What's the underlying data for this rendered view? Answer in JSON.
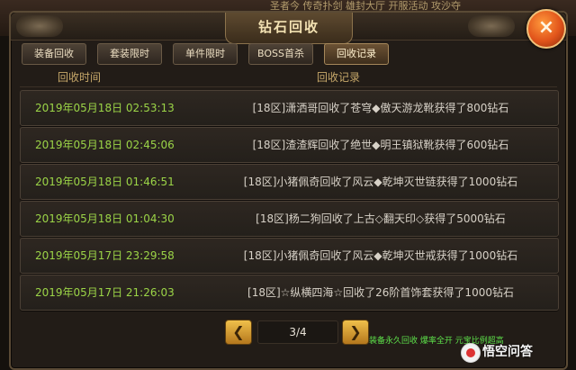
{
  "background": {
    "ticker": "圣者今  传奇扑剑 雄封大厅 开服活动 攻沙夺",
    "bottom_notice": "装备永久回收  爆率全开  元宝比例超高"
  },
  "dialog": {
    "title": "钻石回收",
    "close_label": "×"
  },
  "tabs": [
    {
      "label": "装备回收"
    },
    {
      "label": "套装限时"
    },
    {
      "label": "单件限时"
    },
    {
      "label": "BOSS首杀"
    },
    {
      "label": "回收记录",
      "active": true
    }
  ],
  "table": {
    "headers": {
      "time": "回收时间",
      "record": "回收记录"
    },
    "rows": [
      {
        "time": "2019年05月18日 02:53:13",
        "text": "[18区]潇洒哥回收了苍穹◆傲天游龙靴获得了800钻石"
      },
      {
        "time": "2019年05月18日 02:45:06",
        "text": "[18区]渣渣辉回收了绝世◆明王镇狱靴获得了600钻石"
      },
      {
        "time": "2019年05月18日 01:46:51",
        "text": "[18区]小猪佩奇回收了风云◆乾坤灭世链获得了1000钻石"
      },
      {
        "time": "2019年05月18日 01:04:30",
        "text": "[18区]杨二狗回收了上古◇翻天印◇获得了5000钻石"
      },
      {
        "time": "2019年05月17日 23:29:58",
        "text": "[18区]小猪佩奇回收了风云◆乾坤灭世戒获得了1000钻石"
      },
      {
        "time": "2019年05月17日 21:26:03",
        "text": "[18区]☆纵横四海☆回收了26阶首饰套获得了1000钻石"
      }
    ]
  },
  "pagination": {
    "prev_symbol": "❮",
    "next_symbol": "❯",
    "page_text": "3/4"
  },
  "watermark": {
    "text": "悟空问答"
  },
  "icons": {
    "close": "close-icon",
    "prev": "chevron-left-icon",
    "next": "chevron-right-icon"
  }
}
